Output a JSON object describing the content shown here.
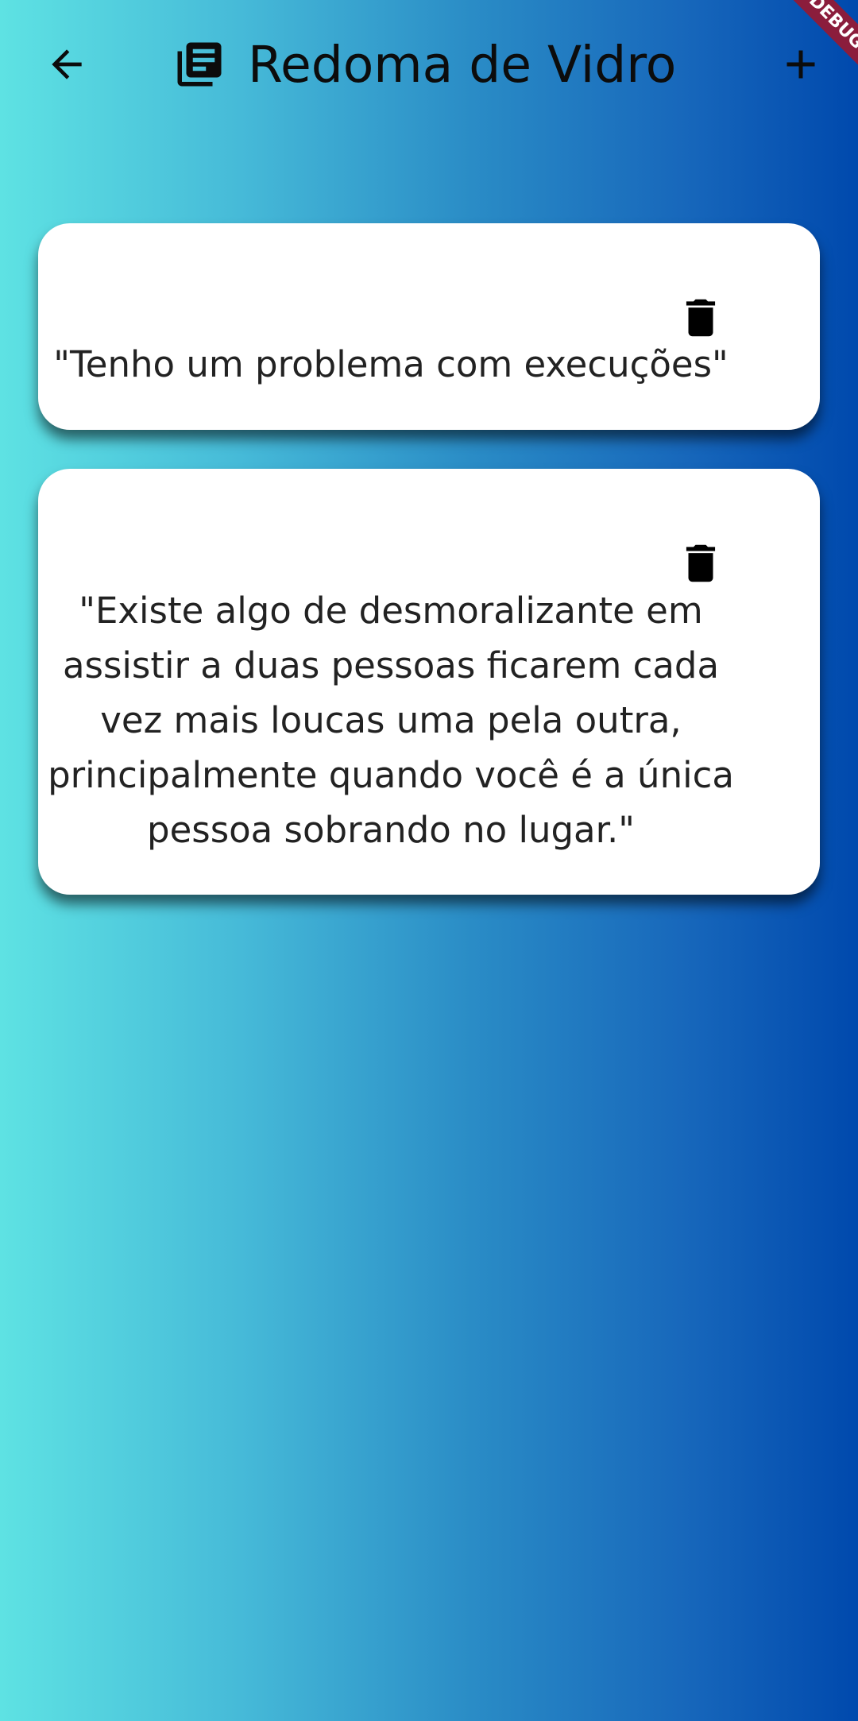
{
  "app_bar": {
    "title": "Redoma de Vidro",
    "back_icon": "arrow-back-icon",
    "title_icon": "library-books-icon",
    "add_icon": "add-icon"
  },
  "debug_banner": {
    "label": "DEBUG",
    "color": "#8b1d3c"
  },
  "background": {
    "gradient_start": "#5ee2e3",
    "gradient_end": "#0049ad"
  },
  "quotes": [
    {
      "text": "\"Tenho um problema com execuções\"",
      "delete_icon": "trash-icon"
    },
    {
      "text": "\"Existe algo de desmoralizante em assistir a duas pessoas ficarem cada vez mais loucas uma pela outra, principalmente quando você é a única pessoa sobrando no lugar.\"",
      "delete_icon": "trash-icon"
    }
  ]
}
